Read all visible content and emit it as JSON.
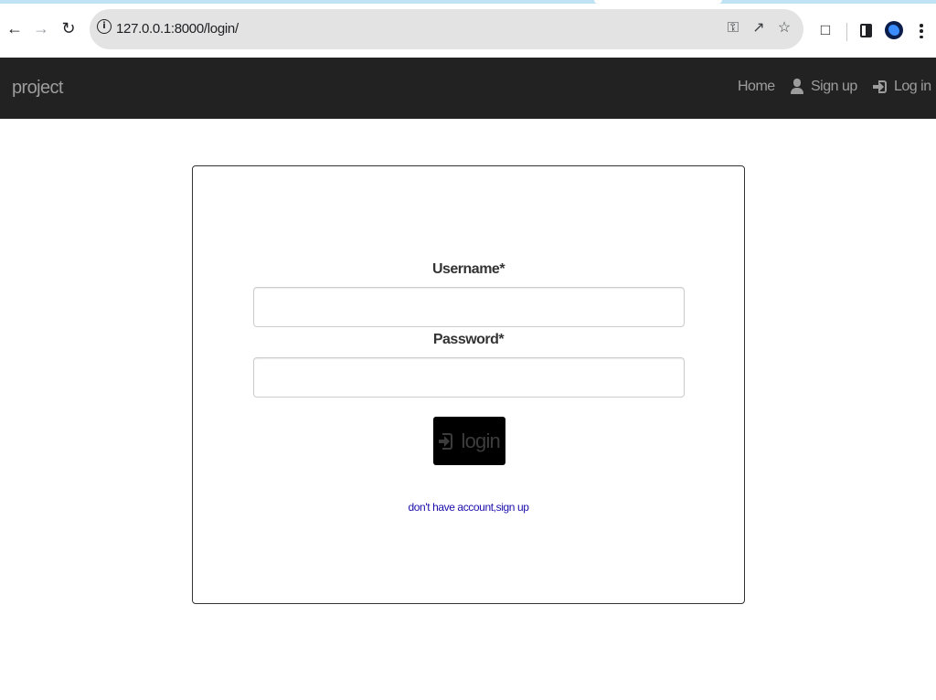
{
  "browser": {
    "url": "127.0.0.1:8000/login/",
    "icons": {
      "back": "back-arrow-icon",
      "forward": "forward-arrow-icon",
      "reload": "reload-icon",
      "site_info": "info-icon",
      "password_key": "key-icon",
      "share": "share-icon",
      "bookmark": "star-icon",
      "extensions": "puzzle-icon",
      "side_panel": "side-panel-icon",
      "profile": "avatar",
      "menu": "kebab-menu-icon"
    }
  },
  "navbar": {
    "brand": "project",
    "links": [
      {
        "label": "Home"
      },
      {
        "label": "Sign up"
      },
      {
        "label": "Log in"
      }
    ],
    "colors": {
      "background": "#222222",
      "text": "#9d9d9d"
    }
  },
  "login_form": {
    "username_label": "Username*",
    "username_value": "",
    "password_label": "Password*",
    "password_value": "",
    "submit_label": "login",
    "signup_link": "don't have account,sign up"
  }
}
